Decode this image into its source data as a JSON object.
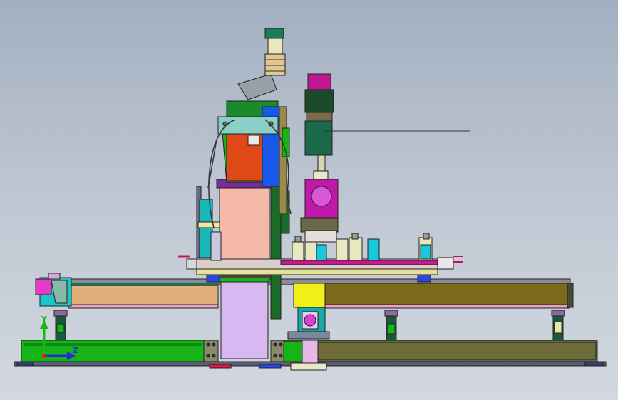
{
  "viewport": {
    "colors": {
      "background_top": "#a3afc1",
      "background_bottom": "#d3d8df"
    }
  },
  "triad": {
    "y_label": "Y",
    "z_label": "Z",
    "colors": {
      "y_axis": "#18b818",
      "z_axis": "#2828e0",
      "origin": "#e01818"
    }
  },
  "model": {
    "parts": [
      "base-frame-left",
      "base-frame-right",
      "gantry-beam-left",
      "gantry-beam-right",
      "center-column",
      "tool-head",
      "spindle-motor",
      "gearbox",
      "worktable",
      "fixtures"
    ],
    "colors": {
      "green": "#16b416",
      "olive": "#6e6a20",
      "tan": "#e0b07a",
      "salmon": "#f6b8a8",
      "lavender": "#d8b8f0",
      "orange": "#e04818",
      "blue": "#1858e8",
      "magenta": "#c01890",
      "cyan": "#18c8c8",
      "yellow": "#f0f018",
      "dark_green": "#1a5a2a",
      "gray": "#9aa0a8"
    }
  }
}
